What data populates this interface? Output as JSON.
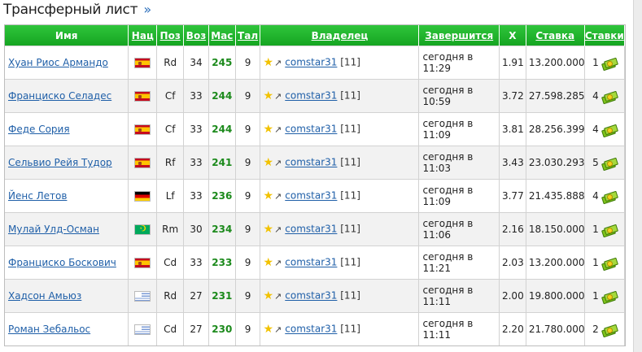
{
  "page": {
    "title": "Трансферный лист",
    "more": "»"
  },
  "columns": {
    "name": "Имя",
    "nat": "Нац",
    "pos": "Поз",
    "age": "Воз",
    "mas": "Мас",
    "tal": "Тал",
    "owner": "Владелец",
    "expires": "Завершится",
    "x": "X",
    "bid": "Ставка",
    "bids": "Ставки"
  },
  "rows": [
    {
      "name": "Хуан Риос Армандо",
      "flag": "es",
      "pos": "Rd",
      "age": "34",
      "mas": "245",
      "tal": "9",
      "owner": "comstar31",
      "level": "[11]",
      "exp1": "сегодня в",
      "exp2": "11:29",
      "x": "1.91",
      "bid": "13.200.000",
      "bids": "1"
    },
    {
      "name": "Франциско Селадес",
      "flag": "es",
      "pos": "Cf",
      "age": "33",
      "mas": "244",
      "tal": "9",
      "owner": "comstar31",
      "level": "[11]",
      "exp1": "сегодня в",
      "exp2": "10:59",
      "x": "3.72",
      "bid": "27.598.285",
      "bids": "4"
    },
    {
      "name": "Феде Сория",
      "flag": "es",
      "pos": "Cf",
      "age": "33",
      "mas": "244",
      "tal": "9",
      "owner": "comstar31",
      "level": "[11]",
      "exp1": "сегодня в",
      "exp2": "11:09",
      "x": "3.81",
      "bid": "28.256.399",
      "bids": "4"
    },
    {
      "name": "Сельвио Рейя Тудор",
      "flag": "es",
      "pos": "Rf",
      "age": "33",
      "mas": "241",
      "tal": "9",
      "owner": "comstar31",
      "level": "[11]",
      "exp1": "сегодня в",
      "exp2": "11:03",
      "x": "3.43",
      "bid": "23.030.293",
      "bids": "5"
    },
    {
      "name": "Йенс Летов",
      "flag": "de",
      "pos": "Lf",
      "age": "33",
      "mas": "236",
      "tal": "9",
      "owner": "comstar31",
      "level": "[11]",
      "exp1": "сегодня в",
      "exp2": "11:09",
      "x": "3.77",
      "bid": "21.435.888",
      "bids": "4"
    },
    {
      "name": "Мулай Улд-Осман",
      "flag": "mr",
      "pos": "Rm",
      "age": "30",
      "mas": "234",
      "tal": "9",
      "owner": "comstar31",
      "level": "[11]",
      "exp1": "сегодня в",
      "exp2": "11:06",
      "x": "2.16",
      "bid": "18.150.000",
      "bids": "1"
    },
    {
      "name": "Франциско Боскович",
      "flag": "es",
      "pos": "Cd",
      "age": "33",
      "mas": "233",
      "tal": "9",
      "owner": "comstar31",
      "level": "[11]",
      "exp1": "сегодня в",
      "exp2": "11:21",
      "x": "2.03",
      "bid": "13.200.000",
      "bids": "1"
    },
    {
      "name": "Хадсон Амьюз",
      "flag": "uy",
      "pos": "Rd",
      "age": "27",
      "mas": "231",
      "tal": "9",
      "owner": "comstar31",
      "level": "[11]",
      "exp1": "сегодня в",
      "exp2": "11:11",
      "x": "2.00",
      "bid": "19.800.000",
      "bids": "1"
    },
    {
      "name": "Роман Зебальос",
      "flag": "uy",
      "pos": "Cd",
      "age": "27",
      "mas": "230",
      "tal": "9",
      "owner": "comstar31",
      "level": "[11]",
      "exp1": "сегодня в",
      "exp2": "11:11",
      "x": "2.20",
      "bid": "21.780.000",
      "bids": "2"
    }
  ],
  "icons": {
    "star": "star-icon",
    "trend": "trend-arrow-icon",
    "bid": "money-bid-icon"
  },
  "colors": {
    "header": "#1fb52c",
    "link": "#1f5fa8",
    "mas": "#1c8a1c"
  }
}
